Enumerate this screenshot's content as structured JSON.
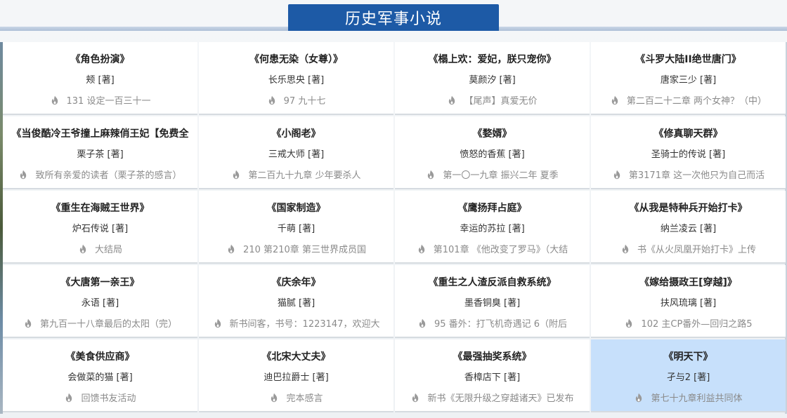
{
  "header": {
    "title": "历史军事小说"
  },
  "books": [
    {
      "title": "《角色扮演》",
      "author": "颊 [著]",
      "latest": "131  设定一百三十一"
    },
    {
      "title": "《何患无染（女尊）》",
      "author": "长乐思央 [著]",
      "latest": "97  九十七"
    },
    {
      "title": "《榻上欢：爱妃，朕只宠你》",
      "author": "莫颜汐 [著]",
      "latest": "【尾声】真爱无价"
    },
    {
      "title": "《斗罗大陆II绝世唐门》",
      "author": "唐家三少 [著]",
      "latest": "第二百二十二章  两个女神？（中）"
    },
    {
      "title": "《当俊酷冷王爷撞上麻辣俏王妃【免费全",
      "author": "栗子茶 [著]",
      "latest": "致所有亲爱的读者（栗子茶的感言）"
    },
    {
      "title": "《小阁老》",
      "author": "三戒大师 [著]",
      "latest": "第二百九十九章  少年要杀人"
    },
    {
      "title": "《婺婿》",
      "author": "愤怒的香蕉 [著]",
      "latest": "第一〇一九章  振兴二年  夏季"
    },
    {
      "title": "《修真聊天群》",
      "author": "圣骑士的传说 [著]",
      "latest": "第3171章  这一次他只为自己而活"
    },
    {
      "title": "《重生在海贼王世界》",
      "author": "炉石传说 [著]",
      "latest": "大结局"
    },
    {
      "title": "《国家制造》",
      "author": "千萌 [著]",
      "latest": "210  第210章  第三世界成员国"
    },
    {
      "title": "《鹰扬拜占庭》",
      "author": "幸运的苏拉 [著]",
      "latest": "第101章  《他改变了罗马》（大结"
    },
    {
      "title": "《从我是特种兵开始打卡》",
      "author": "纳兰凌云 [著]",
      "latest": "书《从火凤凰开始打卡》上传"
    },
    {
      "title": "《大唐第一亲王》",
      "author": "永语 [著]",
      "latest": "第九百一十八章最后的太阳（完）"
    },
    {
      "title": "《庆余年》",
      "author": "猫腻 [著]",
      "latest": "新书间客，书号：1223147，欢迎大"
    },
    {
      "title": "《重生之人渣反派自救系统》",
      "author": "墨香铜臭 [著]",
      "latest": "95  番外：打飞机奇遇记  6（附后"
    },
    {
      "title": "《嫁给摄政王[穿越]》",
      "author": "扶风琉璃 [著]",
      "latest": "102  主CP番外—回归之路5"
    },
    {
      "title": "《美食供应商》",
      "author": "会做菜的猫 [著]",
      "latest": "回馈书友活动"
    },
    {
      "title": "《北宋大丈夫》",
      "author": "迪巴拉爵士 [著]",
      "latest": "完本感言"
    },
    {
      "title": "《最强抽奖系统》",
      "author": "香樟店下 [著]",
      "latest": "新书《无限升级之穿越诸天》已发布"
    },
    {
      "title": "《明天下》",
      "author": "孑与2 [著]",
      "latest": "第七十九章利益共同体"
    }
  ],
  "colors": {
    "tab": "#1d5aa6",
    "active_cell": "#c7e0fb"
  },
  "icons": {
    "latest_icon": "flame-icon"
  }
}
